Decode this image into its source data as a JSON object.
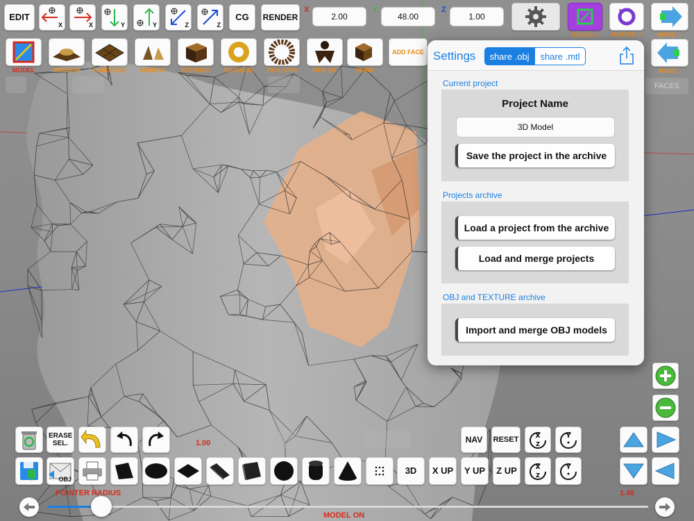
{
  "toolbar_top": {
    "edit": "EDIT",
    "axis_buttons": [
      {
        "label": "X"
      },
      {
        "label": "X"
      },
      {
        "label": "Y"
      },
      {
        "label": "Y"
      },
      {
        "label": "Z"
      },
      {
        "label": "Z"
      }
    ],
    "cg": "CG",
    "render": "RENDER",
    "x_label": "X",
    "y_label": "Y",
    "z_label": "Z",
    "x_value": "2.00",
    "y_value": "48.00",
    "z_value": "1.00",
    "scale_plus": "SCALE +",
    "rotate_plus": "ROTATE +",
    "move_plus": "MOVE +",
    "move_minus": "MOVE -"
  },
  "toolbar_tools": {
    "model": "MODEL",
    "smooth": "SMOOTH",
    "subdivide": "SUBDIVIDE",
    "mirror": "MIRROR",
    "extrude": "EXTRUDE",
    "revolve": "REVOLVE",
    "rev_spin": "REV. SPIN",
    "rev_bf": "REV. BF",
    "vlink": "VLINK",
    "add_face": "ADD FACE",
    "faces": "FACES"
  },
  "settings": {
    "title": "Settings",
    "share_obj": "share .obj",
    "share_mtl": "share .mtl",
    "current_project_header": "Current project",
    "project_name_label": "Project Name",
    "project_name_value": "3D Model",
    "save_button": "Save the project in the archive",
    "projects_archive_header": "Projects archive",
    "load_button": "Load a project from the archive",
    "merge_button": "Load and merge projects",
    "obj_archive_header": "OBJ and TEXTURE archive",
    "import_button": "Import and merge OBJ models"
  },
  "bottom": {
    "erase_sel": "ERASE SEL.",
    "obj": "OBJ",
    "value_left": "1.00",
    "value_right": "1.46",
    "nav": "NAV",
    "reset": "RESET",
    "three_d": "3D",
    "x_up": "X UP",
    "y_up": "Y UP",
    "z_up": "Z UP",
    "pointer_radius": "POINTER RADIUS",
    "model_on": "MODEL ON",
    "pointer_radius_level": 0.09
  },
  "colors": {
    "accent_blue": "#1a7fe0",
    "orange_label": "#e98a1c",
    "red_label": "#d62a1a",
    "purple_button": "#a43fe0",
    "skin": "#e8b088"
  }
}
